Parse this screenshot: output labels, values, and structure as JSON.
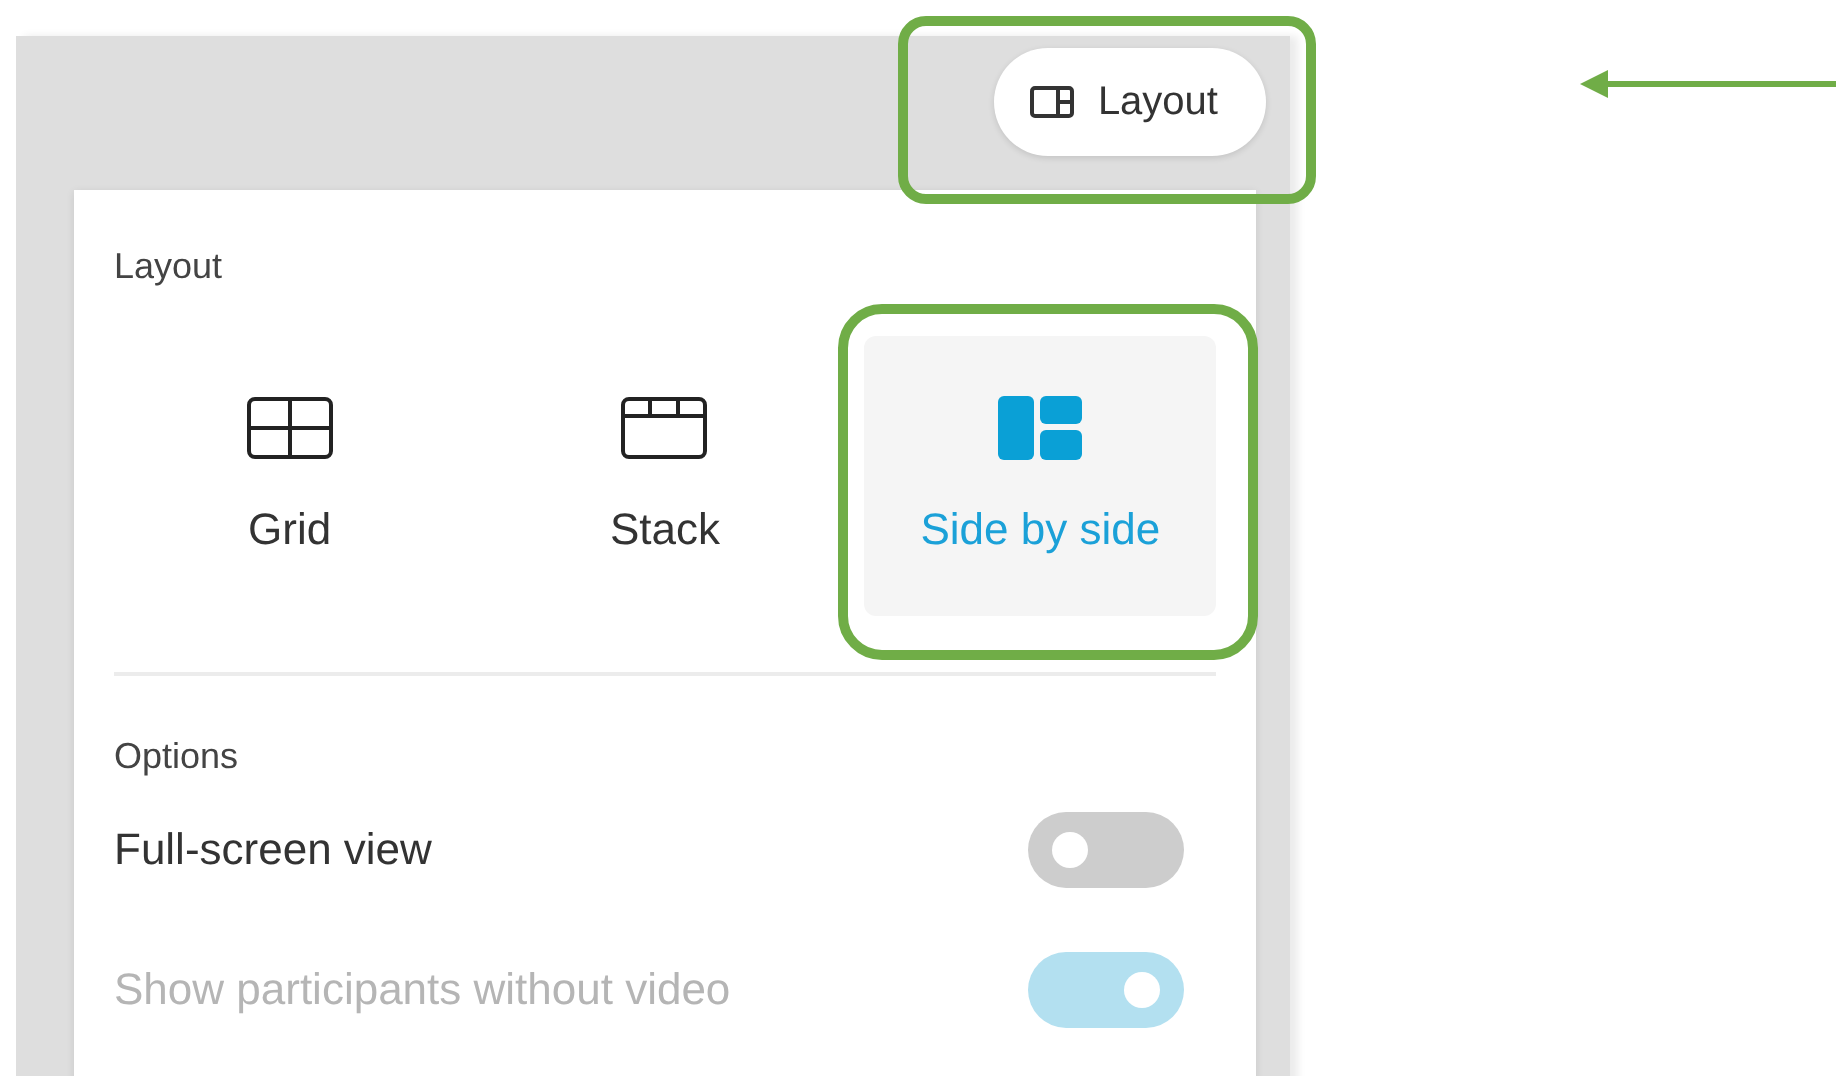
{
  "layout_button": {
    "label": "Layout",
    "highlighted": true
  },
  "panel": {
    "section_title": "Layout",
    "layouts": [
      {
        "kind": "grid",
        "label": "Grid",
        "selected": false,
        "highlighted": false
      },
      {
        "kind": "stack",
        "label": "Stack",
        "selected": false,
        "highlighted": false
      },
      {
        "kind": "side",
        "label": "Side by side",
        "selected": true,
        "highlighted": true
      }
    ],
    "options_title": "Options",
    "options": [
      {
        "label": "Full-screen view",
        "on": false,
        "disabled": false
      },
      {
        "label": "Show participants without video",
        "on": true,
        "disabled": true
      }
    ]
  },
  "annotation_arrow": true
}
